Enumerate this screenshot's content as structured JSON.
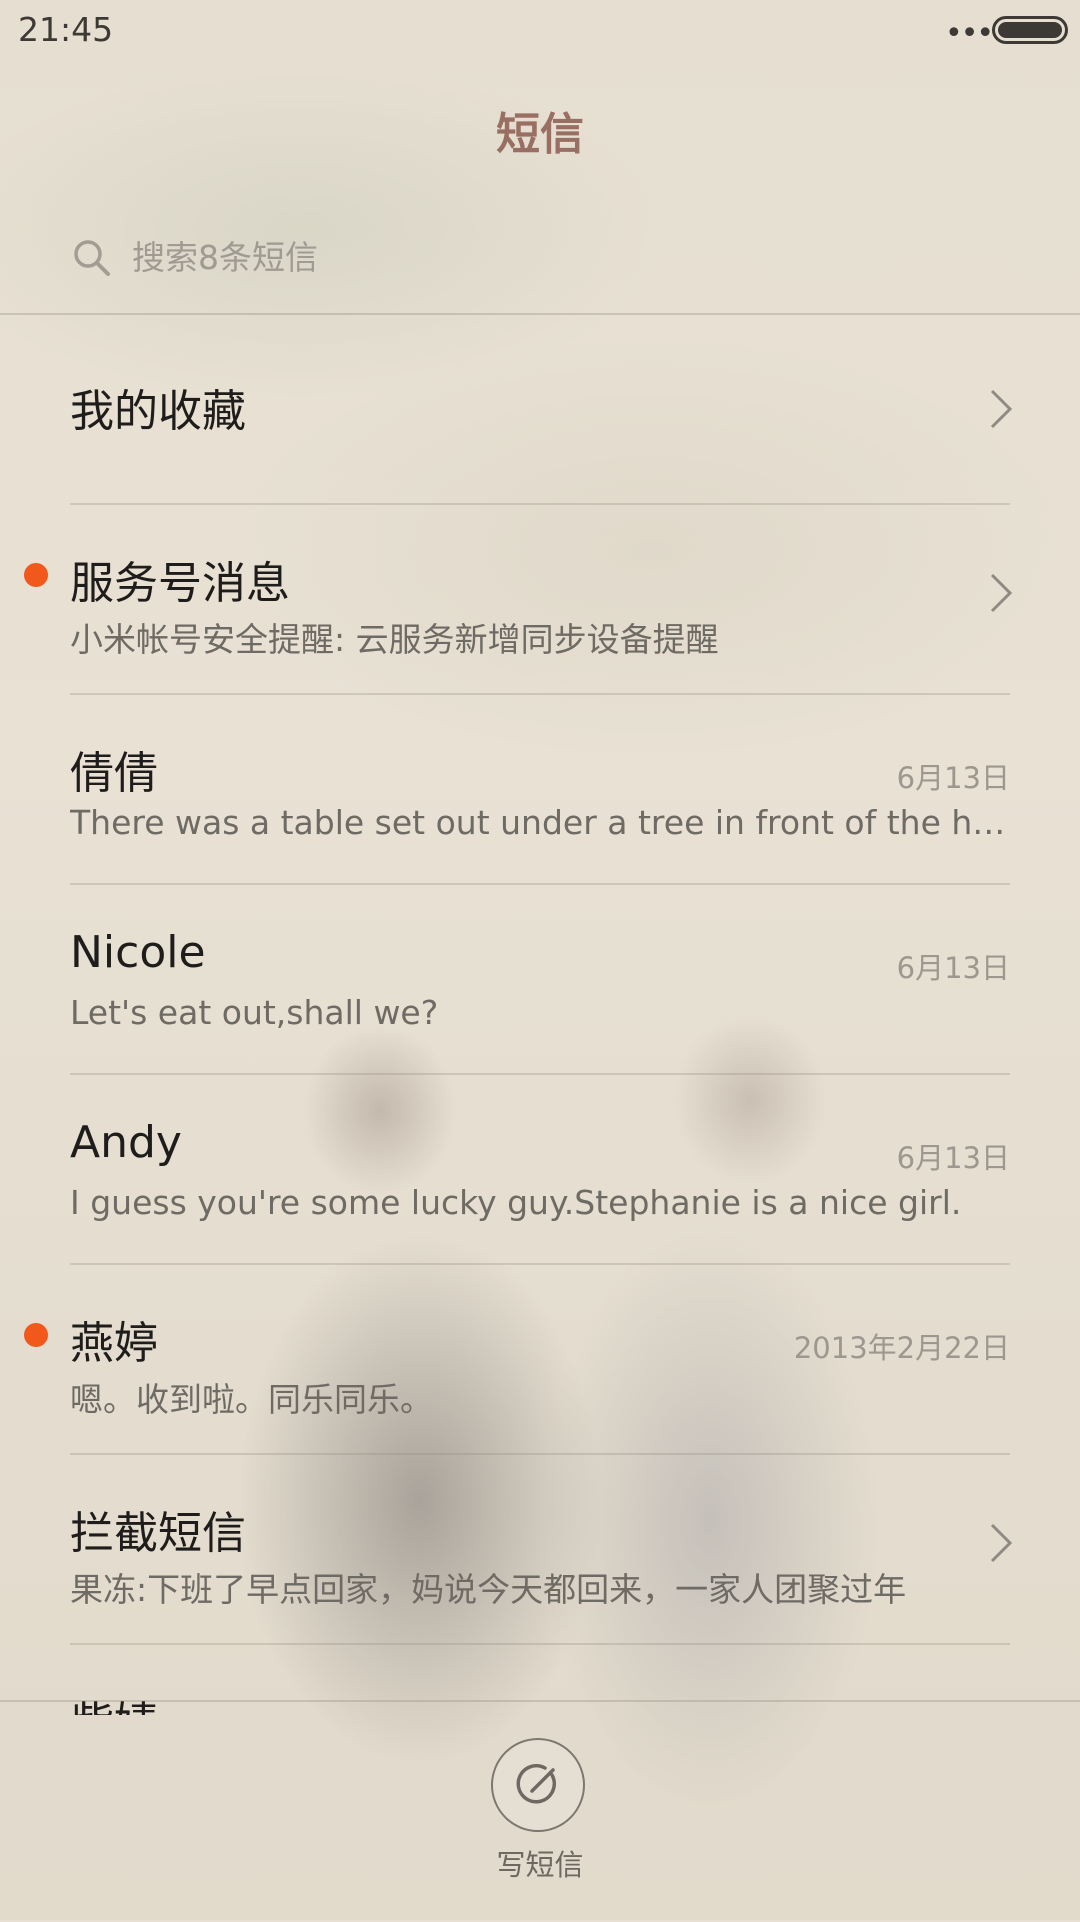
{
  "status_bar": {
    "time": "21:45",
    "overflow_dots": "•••"
  },
  "header": {
    "title": "短信"
  },
  "search": {
    "placeholder": "搜索8条短信"
  },
  "colors": {
    "title": "#9a6f63",
    "unread_dot": "#f2581c"
  },
  "conversations": [
    {
      "title": "我的收藏",
      "subtitle": "",
      "date": "",
      "unread": false,
      "has_chevron": true
    },
    {
      "title": "服务号消息",
      "subtitle": "小米帐号安全提醒: 云服务新增同步设备提醒",
      "date": "",
      "unread": true,
      "has_chevron": true
    },
    {
      "title": "倩倩",
      "subtitle": "There was a table set out under a tree in front of the house",
      "date": "6月13日",
      "unread": false,
      "has_chevron": false
    },
    {
      "title": "Nicole",
      "subtitle": "Let's eat out,shall we?",
      "date": "6月13日",
      "unread": false,
      "has_chevron": false
    },
    {
      "title": "Andy",
      "subtitle": "I guess you're some lucky guy.Stephanie is a nice girl.",
      "date": "6月13日",
      "unread": false,
      "has_chevron": false
    },
    {
      "title": "燕婷",
      "subtitle": "嗯。收到啦。同乐同乐。",
      "date": "2013年2月22日",
      "unread": true,
      "has_chevron": false
    },
    {
      "title": "拦截短信",
      "subtitle": "果冻:下班了早点回家，妈说今天都回来，一家人团聚过年",
      "date": "",
      "unread": false,
      "has_chevron": true
    },
    {
      "title": "紫婧",
      "subtitle": "",
      "date": "",
      "unread": false,
      "has_chevron": false
    }
  ],
  "compose": {
    "label": "写短信"
  }
}
